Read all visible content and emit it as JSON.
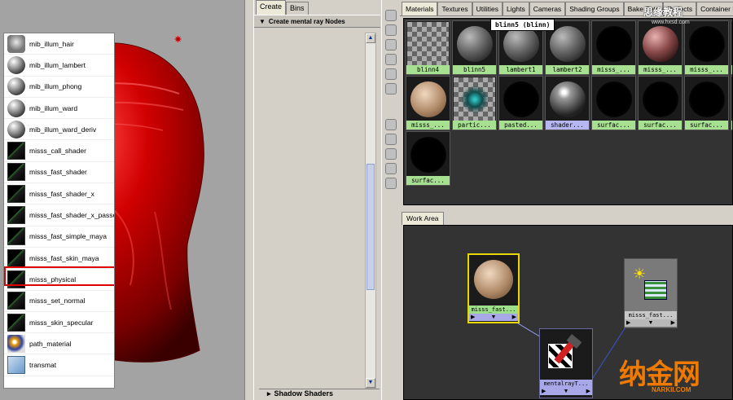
{
  "create_panel": {
    "tabs": [
      "Create",
      "Bins"
    ],
    "section_title": "Create mental ray Nodes",
    "items": [
      {
        "label": "mib_illum_hair",
        "icon": "hair-icon"
      },
      {
        "label": "mib_illum_lambert",
        "icon": "sphere-icon"
      },
      {
        "label": "mib_illum_phong",
        "icon": "sphere-icon"
      },
      {
        "label": "mib_illum_ward",
        "icon": "sphere-icon"
      },
      {
        "label": "mib_illum_ward_deriv",
        "icon": "sphere-icon"
      },
      {
        "label": "misss_call_shader",
        "icon": "shader-icon"
      },
      {
        "label": "misss_fast_shader",
        "icon": "shader-icon"
      },
      {
        "label": "misss_fast_shader_x",
        "icon": "shader-icon"
      },
      {
        "label": "misss_fast_shader_x_passes",
        "icon": "shader-icon"
      },
      {
        "label": "misss_fast_simple_maya",
        "icon": "shader-icon"
      },
      {
        "label": "misss_fast_skin_maya",
        "icon": "shader-icon"
      },
      {
        "label": "misss_physical",
        "icon": "shader-icon"
      },
      {
        "label": "misss_set_normal",
        "icon": "shader-icon"
      },
      {
        "label": "misss_skin_specular",
        "icon": "shader-icon"
      },
      {
        "label": "path_material",
        "icon": "path-material-icon"
      },
      {
        "label": "transmat",
        "icon": "transmat-icon"
      }
    ],
    "highlighted_item": "misss_fast_skin_maya",
    "next_section": "Shadow Shaders"
  },
  "hypershade": {
    "tabs": [
      "Materials",
      "Textures",
      "Utilities",
      "Lights",
      "Cameras",
      "Shading Groups",
      "Bake Sets",
      "Projects",
      "Container Nodes"
    ],
    "active_tab": "Materials",
    "tooltip": "blinn5 (blinn)",
    "swatches": [
      {
        "label": "blinn4",
        "kind": "checker",
        "selected": false
      },
      {
        "label": "blinn5",
        "kind": "grey",
        "selected": false
      },
      {
        "label": "lambert1",
        "kind": "grey",
        "selected": false
      },
      {
        "label": "lambert2",
        "kind": "grey",
        "selected": false
      },
      {
        "label": "misss_...",
        "kind": "black",
        "selected": false
      },
      {
        "label": "misss_...",
        "kind": "red",
        "selected": false
      },
      {
        "label": "misss_...",
        "kind": "black",
        "selected": false
      },
      {
        "label": "m",
        "kind": "black",
        "selected": false
      },
      {
        "label": "misss_...",
        "kind": "skin",
        "selected": false
      },
      {
        "label": "partic...",
        "kind": "particle",
        "selected": false
      },
      {
        "label": "pasted...",
        "kind": "black",
        "selected": false
      },
      {
        "label": "shader...",
        "kind": "glossy",
        "selected": true
      },
      {
        "label": "surfac...",
        "kind": "black",
        "selected": false
      },
      {
        "label": "surfac...",
        "kind": "black",
        "selected": false
      },
      {
        "label": "surfac...",
        "kind": "black",
        "selected": false
      },
      {
        "label": "s",
        "kind": "black",
        "selected": false
      },
      {
        "label": "surfac...",
        "kind": "black",
        "selected": false
      }
    ],
    "work_area_tab": "Work Area",
    "work_nodes": [
      {
        "label": "misss_fast...",
        "kind": "skin"
      },
      {
        "label": "misss_fast...",
        "kind": "lightmap"
      },
      {
        "label": "mentalrayT...",
        "kind": "mentalray"
      }
    ]
  },
  "watermarks": {
    "top_logo": "思缘教程",
    "top_url": "www.hxsd.com",
    "brand": "纳金网",
    "brand_url": "NARKII.COM"
  }
}
